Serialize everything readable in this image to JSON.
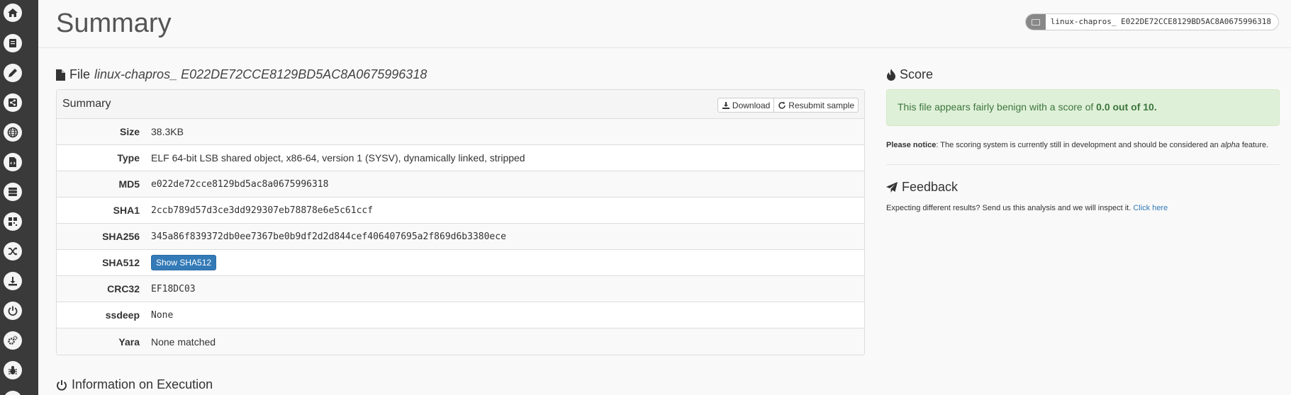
{
  "sidebar": {
    "items": [
      {
        "icon": "home-icon"
      },
      {
        "icon": "book-icon"
      },
      {
        "icon": "pencil-icon"
      },
      {
        "icon": "share-icon"
      },
      {
        "icon": "globe-icon"
      },
      {
        "icon": "code-file-icon"
      },
      {
        "icon": "server-icon"
      },
      {
        "icon": "qrcode-icon"
      },
      {
        "icon": "shuffle-icon"
      },
      {
        "icon": "download-icon"
      },
      {
        "icon": "power-icon"
      },
      {
        "icon": "cogs-icon"
      },
      {
        "icon": "bug-icon"
      }
    ]
  },
  "header": {
    "title": "Summary",
    "task_label": "linux-chapros_ E022DE72CCE8129BD5AC8A0675996318"
  },
  "file": {
    "heading_prefix": "File",
    "filename": "linux-chapros_ E022DE72CCE8129BD5AC8A0675996318"
  },
  "summary": {
    "title": "Summary",
    "download_label": "Download",
    "resubmit_label": "Resubmit sample",
    "rows": {
      "size": {
        "label": "Size",
        "value": "38.3KB"
      },
      "type": {
        "label": "Type",
        "value": "ELF 64-bit LSB shared object, x86-64, version 1 (SYSV), dynamically linked, stripped"
      },
      "md5": {
        "label": "MD5",
        "value": "e022de72cce8129bd5ac8a0675996318"
      },
      "sha1": {
        "label": "SHA1",
        "value": "2ccb789d57d3ce3dd929307eb78878e6e5c61ccf"
      },
      "sha256": {
        "label": "SHA256",
        "value": "345a86f839372db0ee7367be0b9df2d2d844cef406407695a2f869d6b3380ece"
      },
      "sha512": {
        "label": "SHA512",
        "button": "Show SHA512"
      },
      "crc32": {
        "label": "CRC32",
        "value": "EF18DC03"
      },
      "ssdeep": {
        "label": "ssdeep",
        "value": "None"
      },
      "yara": {
        "label": "Yara",
        "value": "None matched"
      }
    }
  },
  "execution": {
    "heading": "Information on Execution"
  },
  "score": {
    "heading": "Score",
    "message_prefix": "This file appears fairly benign with a score of ",
    "message_score": "0.0 out of 10.",
    "notice_bold": "Please notice",
    "notice_text": ": The scoring system is currently still in development and should be considered an ",
    "notice_alpha": "alpha",
    "notice_end": " feature.",
    "success_color": "#dff0d8"
  },
  "feedback": {
    "heading": "Feedback",
    "text": "Expecting different results? Send us this analysis and we will inspect it. ",
    "link": "Click here"
  },
  "colors": {
    "sidebar": "#3a3a3a",
    "primary": "#337ab7",
    "success_text": "#3c763d"
  }
}
